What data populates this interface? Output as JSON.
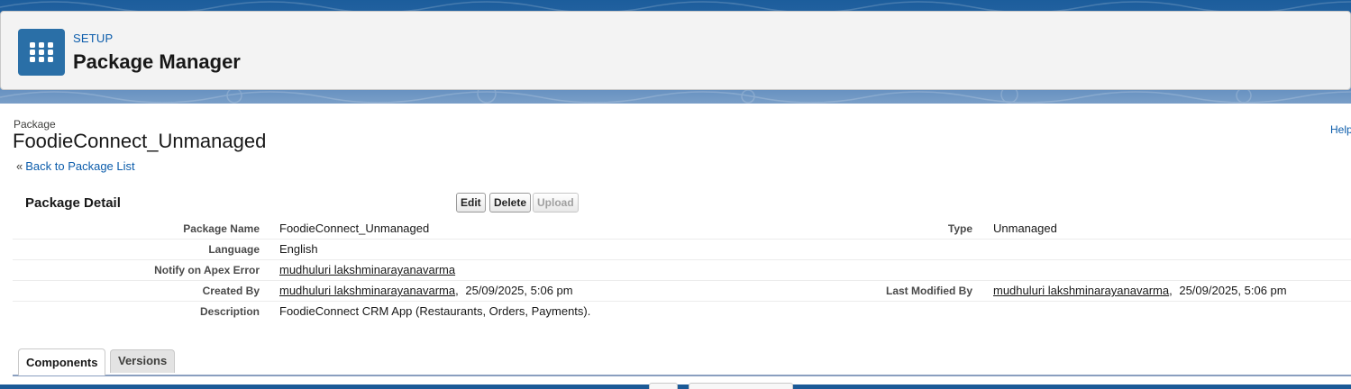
{
  "header": {
    "setup_label": "SETUP",
    "title": "Package Manager",
    "app_icon": "app-launcher-grid-icon"
  },
  "package": {
    "type_label": "Package",
    "name": "FoodieConnect_Unmanaged",
    "help_label": "Help",
    "back_link": "Back to Package List",
    "back_chevron": "«"
  },
  "detail": {
    "title": "Package Detail",
    "buttons": {
      "edit": "Edit",
      "delete": "Delete",
      "upload": "Upload"
    },
    "rows": [
      {
        "label": "Package Name",
        "value": "FoodieConnect_Unmanaged",
        "label2": "Type",
        "value2": "Unmanaged"
      },
      {
        "label": "Language",
        "value": "English"
      },
      {
        "label": "Notify on Apex Error",
        "value": "mudhuluri lakshminarayanavarma"
      },
      {
        "label": "Created By",
        "value_user": "mudhuluri lakshminarayanavarma",
        "value_date": "25/09/2025, 5:06 pm",
        "label2": "Last Modified By",
        "value2_user": "mudhuluri lakshminarayanavarma",
        "value2_date": "25/09/2025, 5:06 pm"
      },
      {
        "label": "Description",
        "value": "FoodieConnect CRM App (Restaurants, Orders, Payments)."
      }
    ]
  },
  "tabs": [
    {
      "label": "Components",
      "active": true
    },
    {
      "label": "Versions",
      "active": false
    }
  ],
  "colors": {
    "brand_blue": "#1b5a97",
    "link": "#0b5cab",
    "tile": "#2a6fa7"
  }
}
